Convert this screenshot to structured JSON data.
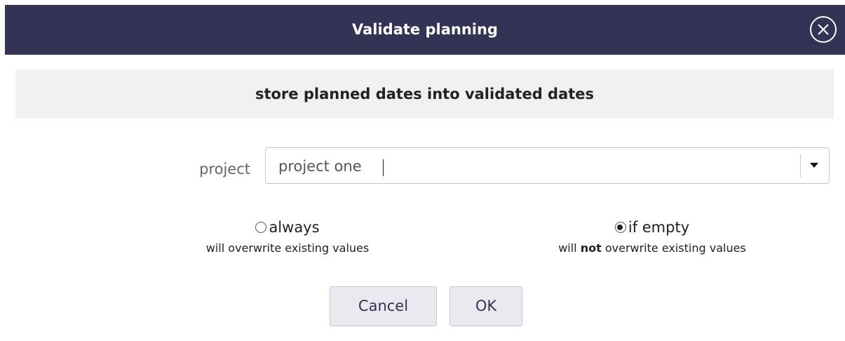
{
  "dialog": {
    "title": "Validate planning",
    "subtitle": "store planned dates into validated dates",
    "close_icon": "close-circle-icon"
  },
  "project_field": {
    "label": "project",
    "value": "project one",
    "dropdown_icon": "caret-down-icon"
  },
  "overwrite_mode": {
    "selected": "if empty",
    "options": [
      {
        "label": "always",
        "hint": "will overwrite existing values",
        "checked": false
      },
      {
        "label": "if empty",
        "hint_pre": "will ",
        "hint_bold": "not",
        "hint_post": " overwrite existing values",
        "checked": true
      }
    ]
  },
  "buttons": {
    "cancel_label": "Cancel",
    "ok_label": "OK"
  },
  "colors": {
    "titlebar_bg": "#333355",
    "subtitle_bg": "#f0f0f0",
    "button_bg": "#e9e9f0",
    "button_text": "#333355"
  }
}
